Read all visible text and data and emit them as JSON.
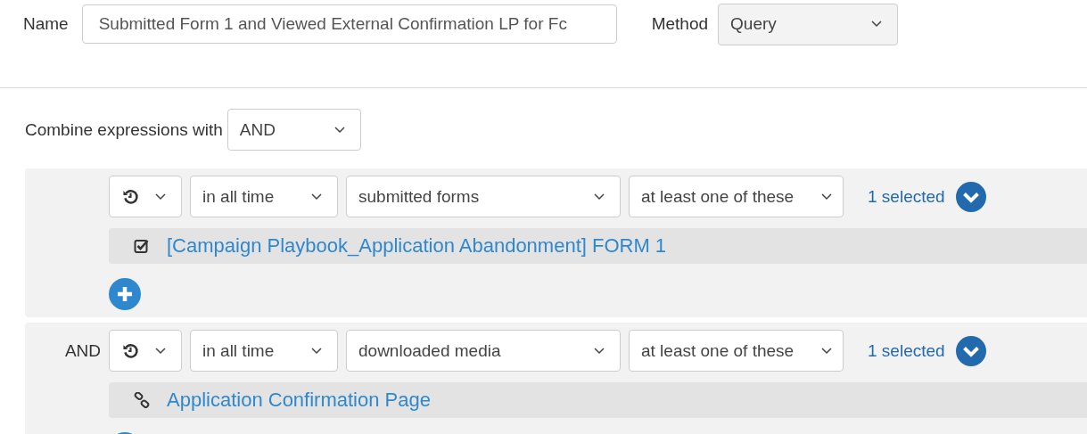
{
  "name_field": {
    "label": "Name",
    "value": "Submitted Form 1 and Viewed External Confirmation LP for Fc"
  },
  "method": {
    "label": "Method",
    "value": "Query"
  },
  "combine": {
    "label": "Combine expressions with",
    "value": "AND"
  },
  "expressions": [
    {
      "time": "in all time",
      "action": "submitted forms",
      "qualifier": "at least one of these",
      "selected_count": "1 selected",
      "items": [
        {
          "kind": "form",
          "label": "[Campaign Playbook_Application Abandonment] FORM 1"
        }
      ]
    },
    {
      "connector": "AND",
      "time": "in all time",
      "action": "downloaded media",
      "qualifier": "at least one of these",
      "selected_count": "1 selected",
      "items": [
        {
          "kind": "link",
          "label": "Application Confirmation Page"
        }
      ]
    }
  ]
}
